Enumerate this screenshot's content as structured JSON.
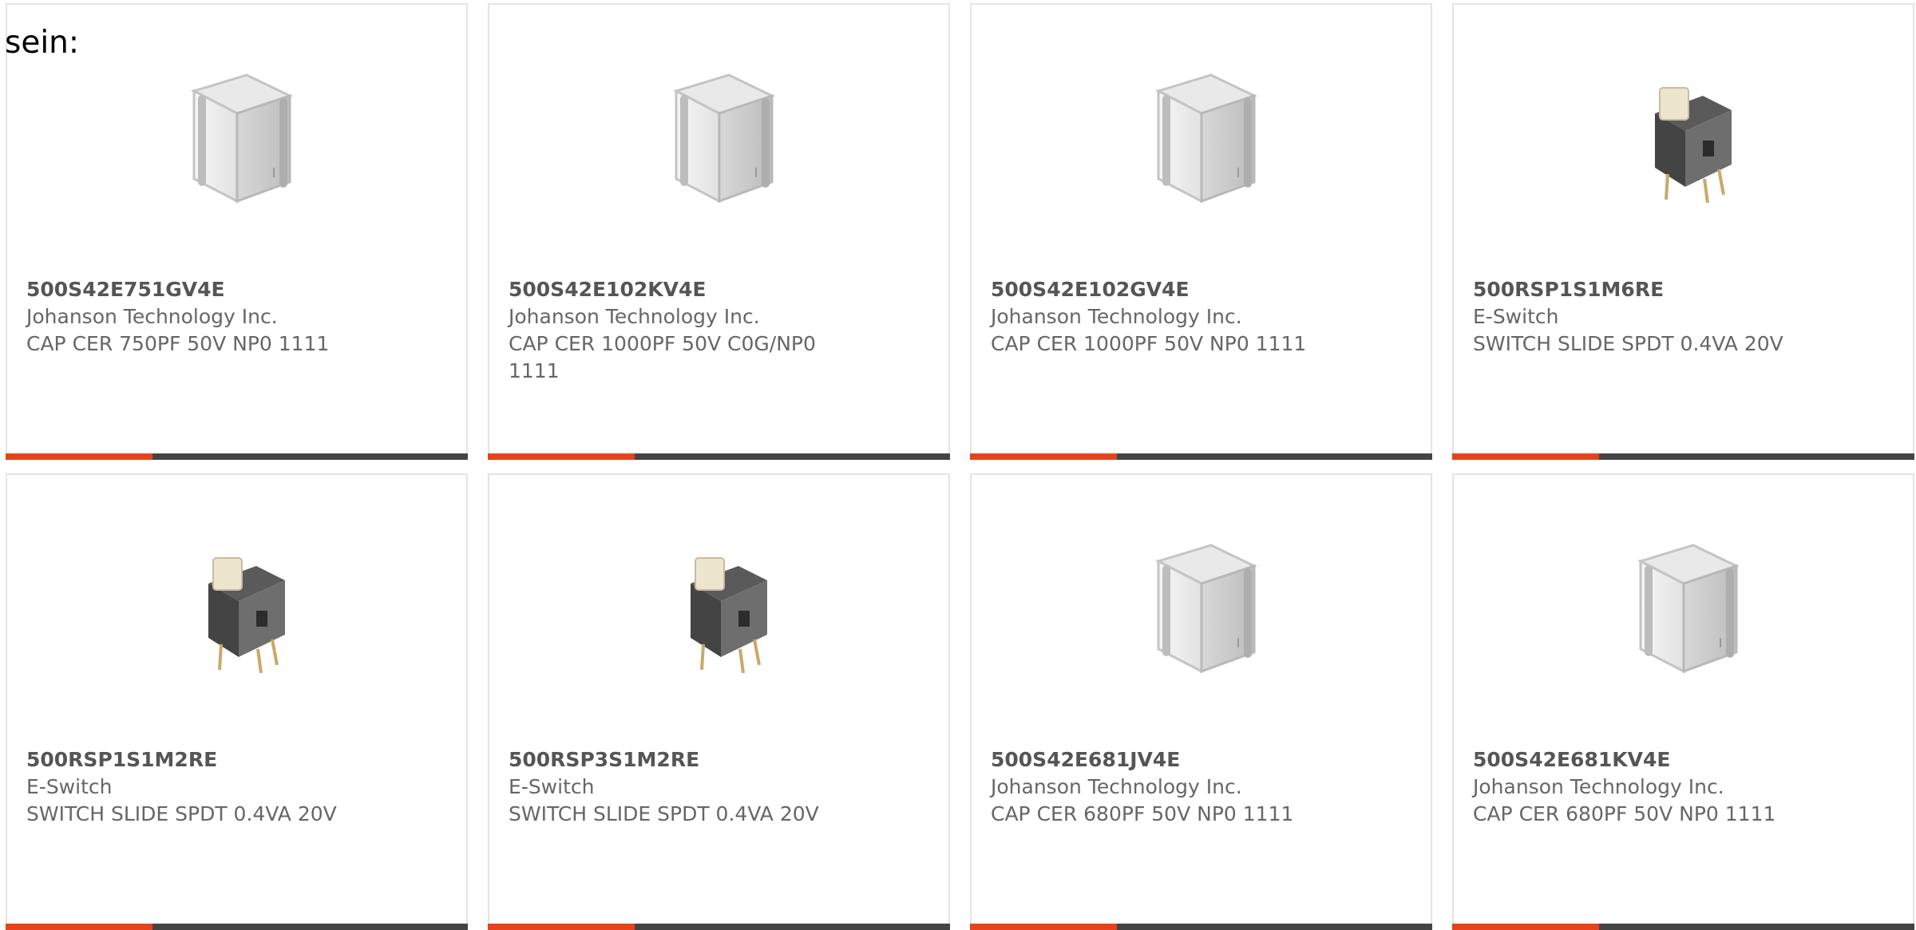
{
  "lead_text": "sein:",
  "accent_color": "#e8421b",
  "bar_color": "#444444",
  "products": [
    {
      "part_number": "500S42E751GV4E",
      "manufacturer": "Johanson Technology Inc.",
      "description": "CAP CER 750PF 50V NP0 1111",
      "icon": "ceramic-capacitor-icon"
    },
    {
      "part_number": "500S42E102KV4E",
      "manufacturer": "Johanson Technology Inc.",
      "description": "CAP CER 1000PF 50V C0G/NP0 1111",
      "icon": "ceramic-capacitor-icon"
    },
    {
      "part_number": "500S42E102GV4E",
      "manufacturer": "Johanson Technology Inc.",
      "description": "CAP CER 1000PF 50V NP0 1111",
      "icon": "ceramic-capacitor-icon"
    },
    {
      "part_number": "500RSP1S1M6RE",
      "manufacturer": "E-Switch",
      "description": "SWITCH SLIDE SPDT 0.4VA 20V",
      "icon": "slide-switch-icon"
    },
    {
      "part_number": "500RSP1S1M2RE",
      "manufacturer": "E-Switch",
      "description": "SWITCH SLIDE SPDT 0.4VA 20V",
      "icon": "slide-switch-icon"
    },
    {
      "part_number": "500RSP3S1M2RE",
      "manufacturer": "E-Switch",
      "description": "SWITCH SLIDE SPDT 0.4VA 20V",
      "icon": "slide-switch-icon"
    },
    {
      "part_number": "500S42E681JV4E",
      "manufacturer": "Johanson Technology Inc.",
      "description": "CAP CER 680PF 50V NP0 1111",
      "icon": "ceramic-capacitor-icon"
    },
    {
      "part_number": "500S42E681KV4E",
      "manufacturer": "Johanson Technology Inc.",
      "description": "CAP CER 680PF 50V NP0 1111",
      "icon": "ceramic-capacitor-icon"
    }
  ]
}
